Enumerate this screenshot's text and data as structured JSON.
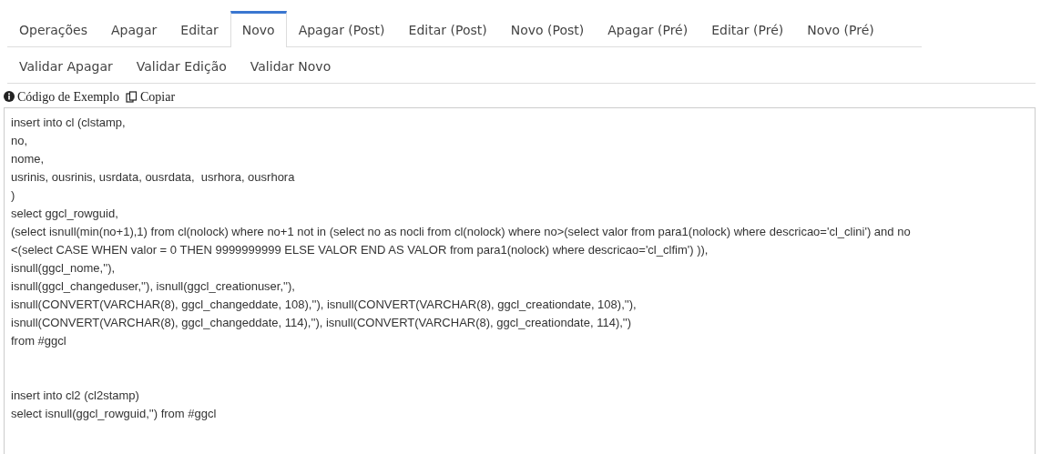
{
  "tab_rows": [
    {
      "tabs": [
        {
          "label": "Operações",
          "selected": false
        },
        {
          "label": "Apagar",
          "selected": false
        },
        {
          "label": "Editar",
          "selected": false
        },
        {
          "label": "Novo",
          "selected": true
        },
        {
          "label": "Apagar (Post)",
          "selected": false
        },
        {
          "label": "Editar (Post)",
          "selected": false
        },
        {
          "label": "Novo (Post)",
          "selected": false
        },
        {
          "label": "Apagar (Pré)",
          "selected": false
        },
        {
          "label": "Editar (Pré)",
          "selected": false
        },
        {
          "label": "Novo (Pré)",
          "selected": false
        }
      ]
    },
    {
      "tabs": [
        {
          "label": "Validar Apagar",
          "selected": false
        },
        {
          "label": "Validar Edição",
          "selected": false
        },
        {
          "label": "Validar Novo",
          "selected": false
        }
      ]
    }
  ],
  "example_header": {
    "title": "Código de Exemplo",
    "copy_link": "Copiar"
  },
  "code": {
    "blocks": [
      [
        "insert into cl (clstamp,",
        "no,",
        "nome,",
        "usrinis, ousrinis, usrdata, ousrdata,  usrhora, ousrhora",
        ")",
        "select ggcl_rowguid,",
        "(select isnull(min(no+1),1) from cl(nolock) where no+1 not in (select no as nocli from cl(nolock) where no>(select valor from para1(nolock) where descricao='cl_clini') and no",
        "<(select CASE WHEN valor = 0 THEN 9999999999 ELSE VALOR END AS VALOR from para1(nolock) where descricao='cl_clfim') )),",
        "isnull(ggcl_nome,''),",
        "isnull(ggcl_changeduser,''), isnull(ggcl_creationuser,''),",
        "isnull(CONVERT(VARCHAR(8), ggcl_changeddate, 108),''), isnull(CONVERT(VARCHAR(8), ggcl_creationdate, 108),''),",
        "isnull(CONVERT(VARCHAR(8), ggcl_changeddate, 114),''), isnull(CONVERT(VARCHAR(8), ggcl_creationdate, 114),'')",
        "from #ggcl"
      ],
      [
        "insert into cl2 (cl2stamp)",
        "select isnull(ggcl_rowguid,'') from #ggcl"
      ]
    ]
  }
}
